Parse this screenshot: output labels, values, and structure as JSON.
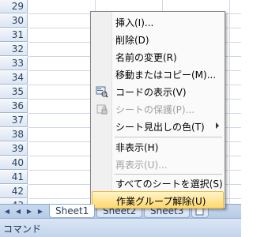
{
  "rows": [
    "29",
    "30",
    "31",
    "32",
    "33",
    "34",
    "35",
    "36",
    "37",
    "38",
    "39",
    "40",
    "41",
    "42",
    "43"
  ],
  "tabs": [
    "Sheet1",
    "Sheet2",
    "Sheet3"
  ],
  "tab_nav": {
    "first": "◀",
    "prev": "◀",
    "next": "▶",
    "last": "▶"
  },
  "status": "コマンド",
  "menu": {
    "insert": "挿入(I)...",
    "delete": "削除(D)",
    "rename": "名前の変更(R)",
    "move_copy": "移動またはコピー(M)...",
    "view_code": "コードの表示(V)",
    "protect_sheet": "シートの保護(P)...",
    "tab_color": "シート見出しの色(T)",
    "hide": "非表示(H)",
    "unhide": "再表示(U)...",
    "select_all": "すべてのシートを選択(S)",
    "ungroup": "作業グループ解除(U)"
  }
}
